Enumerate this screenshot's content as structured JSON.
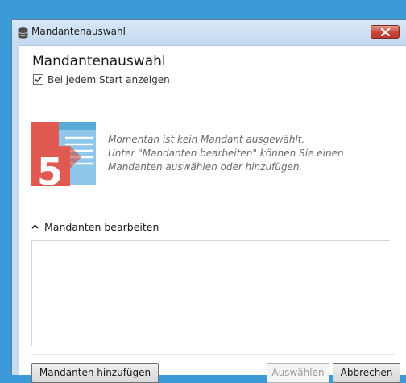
{
  "window": {
    "title": "Mandantenauswahl",
    "icon": "database-icon",
    "close_icon": "close-icon"
  },
  "dialog": {
    "heading": "Mandantenauswahl",
    "show_on_start": {
      "label": "Bei jedem Start anzeigen",
      "checked": true
    },
    "logo": {
      "icon": "app-logo-5",
      "digit": "5",
      "colors": {
        "red": "#e05a52",
        "blue": "#5aaad8"
      }
    },
    "message": {
      "line1": "Momentan ist kein Mandant ausgewählt.",
      "line2": "Unter \"Mandanten bearbeiten\" können Sie einen",
      "line3": "Mandanten auswählen oder hinzufügen."
    },
    "expander": {
      "label": "Mandanten bearbeiten",
      "icon": "chevron-up-icon",
      "expanded": true
    },
    "mandanten_list": []
  },
  "buttons": {
    "add": "Mandanten hinzufügen",
    "select": "Auswählen",
    "cancel": "Abbrechen"
  }
}
